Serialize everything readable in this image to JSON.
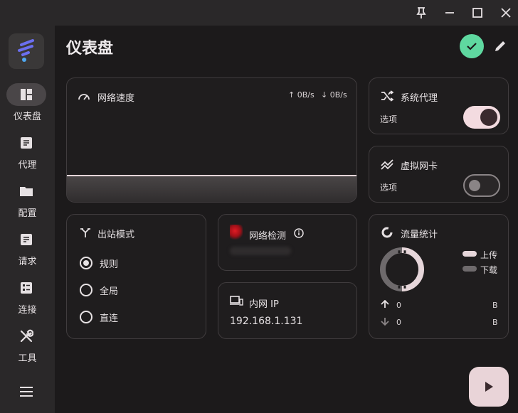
{
  "header": {
    "title": "仪表盘"
  },
  "nav": {
    "items": [
      {
        "label": "仪表盘",
        "icon": "dashboard-icon",
        "active": true
      },
      {
        "label": "代理",
        "icon": "proxy-list-icon"
      },
      {
        "label": "配置",
        "icon": "folder-icon"
      },
      {
        "label": "请求",
        "icon": "rules-icon"
      },
      {
        "label": "连接",
        "icon": "connections-icon"
      },
      {
        "label": "工具",
        "icon": "tools-icon"
      }
    ]
  },
  "speed_card": {
    "title": "网络速度",
    "upload": "↑ 0B/s",
    "download": "↓ 0B/s"
  },
  "system_proxy": {
    "title": "系统代理",
    "option_label": "选项",
    "enabled": true
  },
  "tun": {
    "title": "虚拟网卡",
    "option_label": "选项",
    "enabled": false
  },
  "outbound_mode": {
    "title": "出站模式",
    "options": [
      {
        "label": "规则",
        "selected": true
      },
      {
        "label": "全局",
        "selected": false
      },
      {
        "label": "直连",
        "selected": false
      }
    ]
  },
  "network_check": {
    "title": "网络检测"
  },
  "intranet_ip": {
    "title": "内网 IP",
    "value": "192.168.1.131"
  },
  "traffic": {
    "title": "流量统计",
    "legend_upload": "上传",
    "legend_download": "下载",
    "upload_value": "0",
    "upload_unit": "B",
    "download_value": "0",
    "download_unit": "B"
  },
  "colors": {
    "accent": "#5fd8a0",
    "toggle_on": "#f3dbe0",
    "play_button": "#e9d4d8"
  }
}
